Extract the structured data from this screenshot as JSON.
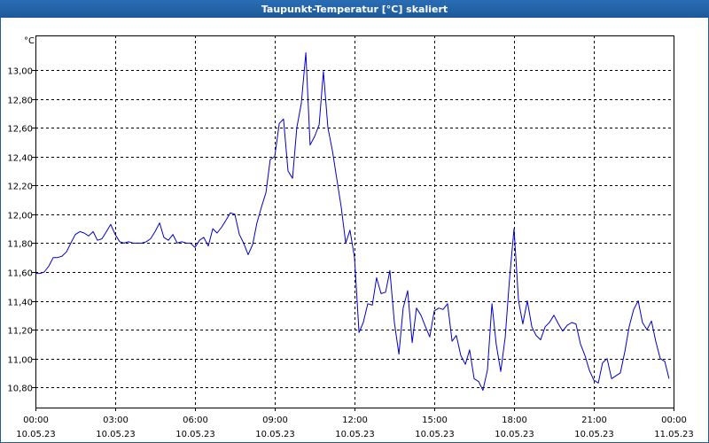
{
  "window": {
    "title": "Taupunkt-Temperatur [°C] skaliert"
  },
  "chart_data": {
    "type": "line",
    "title": "Taupunkt-Temperatur [°C] skaliert",
    "y_unit": "°C",
    "ylim": [
      10.66,
      13.24
    ],
    "y_ticks": [
      "10,80",
      "11,00",
      "11,20",
      "11,40",
      "11,60",
      "11,80",
      "12,00",
      "12,20",
      "12,40",
      "12,60",
      "12,80",
      "13,00"
    ],
    "y_tick_values": [
      10.8,
      11.0,
      11.2,
      11.4,
      11.6,
      11.8,
      12.0,
      12.2,
      12.4,
      12.6,
      12.8,
      13.0
    ],
    "x_ticks": [
      {
        "time": "00:00",
        "date": "10.05.23",
        "hour": 0
      },
      {
        "time": "03:00",
        "date": "10.05.23",
        "hour": 3
      },
      {
        "time": "06:00",
        "date": "10.05.23",
        "hour": 6
      },
      {
        "time": "09:00",
        "date": "10.05.23",
        "hour": 9
      },
      {
        "time": "12:00",
        "date": "10.05.23",
        "hour": 12
      },
      {
        "time": "15:00",
        "date": "10.05.23",
        "hour": 15
      },
      {
        "time": "18:00",
        "date": "10.05.23",
        "hour": 18
      },
      {
        "time": "21:00",
        "date": "10.05.23",
        "hour": 21
      },
      {
        "time": "00:00",
        "date": "11.05.23",
        "hour": 24
      }
    ],
    "xlim": [
      0,
      24
    ],
    "grid": true,
    "series": [
      {
        "color": "#0000cc",
        "points": [
          [
            0.0,
            11.59
          ],
          [
            0.17,
            11.59
          ],
          [
            0.33,
            11.6
          ],
          [
            0.5,
            11.64
          ],
          [
            0.67,
            11.7
          ],
          [
            0.83,
            11.7
          ],
          [
            1.0,
            11.71
          ],
          [
            1.17,
            11.74
          ],
          [
            1.33,
            11.8
          ],
          [
            1.5,
            11.86
          ],
          [
            1.67,
            11.88
          ],
          [
            1.83,
            11.87
          ],
          [
            2.0,
            11.85
          ],
          [
            2.17,
            11.88
          ],
          [
            2.33,
            11.82
          ],
          [
            2.5,
            11.83
          ],
          [
            2.67,
            11.88
          ],
          [
            2.83,
            11.93
          ],
          [
            3.0,
            11.86
          ],
          [
            3.17,
            11.81
          ],
          [
            3.33,
            11.8
          ],
          [
            3.5,
            11.81
          ],
          [
            3.67,
            11.8
          ],
          [
            3.83,
            11.8
          ],
          [
            4.0,
            11.8
          ],
          [
            4.17,
            11.81
          ],
          [
            4.33,
            11.83
          ],
          [
            4.5,
            11.88
          ],
          [
            4.67,
            11.94
          ],
          [
            4.83,
            11.84
          ],
          [
            5.0,
            11.82
          ],
          [
            5.17,
            11.86
          ],
          [
            5.33,
            11.8
          ],
          [
            5.5,
            11.81
          ],
          [
            5.67,
            11.8
          ],
          [
            5.83,
            11.8
          ],
          [
            6.0,
            11.77
          ],
          [
            6.17,
            11.82
          ],
          [
            6.33,
            11.84
          ],
          [
            6.5,
            11.78
          ],
          [
            6.67,
            11.9
          ],
          [
            6.83,
            11.87
          ],
          [
            7.0,
            11.91
          ],
          [
            7.17,
            11.96
          ],
          [
            7.33,
            12.01
          ],
          [
            7.5,
            12.0
          ],
          [
            7.67,
            11.86
          ],
          [
            7.83,
            11.8
          ],
          [
            8.0,
            11.72
          ],
          [
            8.17,
            11.79
          ],
          [
            8.33,
            11.94
          ],
          [
            8.5,
            12.05
          ],
          [
            8.67,
            12.15
          ],
          [
            8.83,
            12.38
          ],
          [
            9.0,
            12.4
          ],
          [
            9.17,
            12.63
          ],
          [
            9.33,
            12.66
          ],
          [
            9.5,
            12.3
          ],
          [
            9.67,
            12.25
          ],
          [
            9.83,
            12.6
          ],
          [
            10.0,
            12.77
          ],
          [
            10.17,
            13.12
          ],
          [
            10.33,
            12.48
          ],
          [
            10.5,
            12.54
          ],
          [
            10.67,
            12.62
          ],
          [
            10.83,
            12.99
          ],
          [
            11.0,
            12.6
          ],
          [
            11.17,
            12.44
          ],
          [
            11.33,
            12.25
          ],
          [
            11.5,
            12.05
          ],
          [
            11.67,
            11.8
          ],
          [
            11.83,
            11.89
          ],
          [
            12.0,
            11.7
          ],
          [
            12.17,
            11.18
          ],
          [
            12.33,
            11.25
          ],
          [
            12.5,
            11.38
          ],
          [
            12.67,
            11.37
          ],
          [
            12.83,
            11.56
          ],
          [
            13.0,
            11.45
          ],
          [
            13.17,
            11.46
          ],
          [
            13.33,
            11.61
          ],
          [
            13.5,
            11.25
          ],
          [
            13.67,
            11.03
          ],
          [
            13.83,
            11.35
          ],
          [
            14.0,
            11.47
          ],
          [
            14.17,
            11.11
          ],
          [
            14.33,
            11.35
          ],
          [
            14.5,
            11.3
          ],
          [
            14.67,
            11.22
          ],
          [
            14.83,
            11.15
          ],
          [
            15.0,
            11.33
          ],
          [
            15.17,
            11.35
          ],
          [
            15.33,
            11.34
          ],
          [
            15.5,
            11.38
          ],
          [
            15.67,
            11.12
          ],
          [
            15.83,
            11.16
          ],
          [
            16.0,
            11.02
          ],
          [
            16.17,
            10.96
          ],
          [
            16.33,
            11.06
          ],
          [
            16.5,
            10.86
          ],
          [
            16.67,
            10.84
          ],
          [
            16.83,
            10.78
          ],
          [
            17.0,
            10.92
          ],
          [
            17.17,
            11.38
          ],
          [
            17.33,
            11.1
          ],
          [
            17.5,
            10.91
          ],
          [
            17.67,
            11.15
          ],
          [
            17.83,
            11.55
          ],
          [
            18.0,
            11.9
          ],
          [
            18.17,
            11.4
          ],
          [
            18.33,
            11.24
          ],
          [
            18.5,
            11.4
          ],
          [
            18.67,
            11.22
          ],
          [
            18.83,
            11.16
          ],
          [
            19.0,
            11.13
          ],
          [
            19.17,
            11.22
          ],
          [
            19.33,
            11.25
          ],
          [
            19.5,
            11.3
          ],
          [
            19.67,
            11.24
          ],
          [
            19.83,
            11.19
          ],
          [
            20.0,
            11.23
          ],
          [
            20.17,
            11.25
          ],
          [
            20.33,
            11.24
          ],
          [
            20.5,
            11.1
          ],
          [
            20.67,
            11.02
          ],
          [
            20.83,
            10.92
          ],
          [
            21.0,
            10.85
          ],
          [
            21.17,
            10.83
          ],
          [
            21.33,
            10.97
          ],
          [
            21.5,
            11.0
          ],
          [
            21.67,
            10.86
          ],
          [
            21.83,
            10.88
          ],
          [
            22.0,
            10.9
          ],
          [
            22.17,
            11.05
          ],
          [
            22.33,
            11.22
          ],
          [
            22.5,
            11.34
          ],
          [
            22.67,
            11.4
          ],
          [
            22.83,
            11.25
          ],
          [
            23.0,
            11.2
          ],
          [
            23.17,
            11.26
          ],
          [
            23.33,
            11.12
          ],
          [
            23.5,
            11.0
          ],
          [
            23.67,
            10.98
          ],
          [
            23.83,
            10.86
          ]
        ]
      }
    ]
  }
}
